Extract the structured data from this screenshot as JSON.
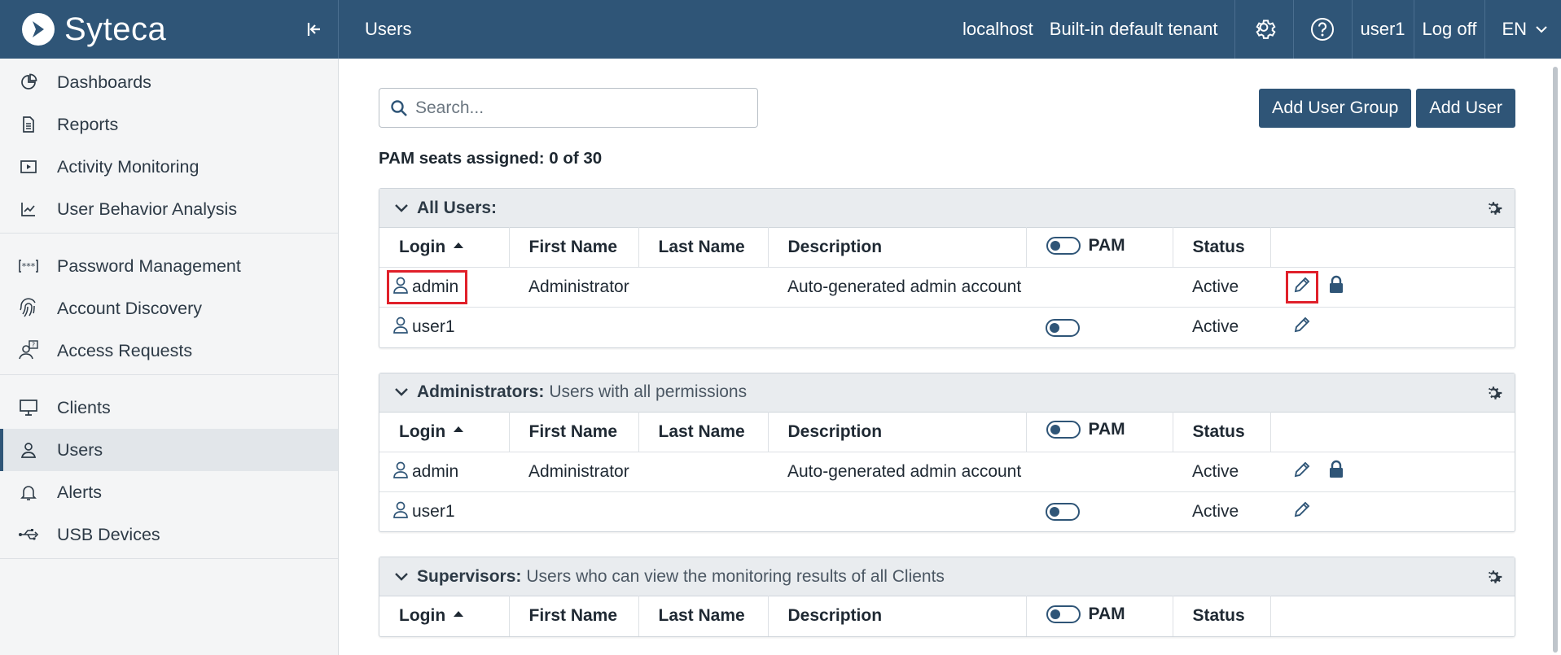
{
  "app": {
    "brand": "Syteca"
  },
  "header": {
    "page_title": "Users",
    "host": "localhost",
    "tenant": "Built-in default tenant",
    "user": "user1",
    "logoff": "Log off",
    "lang": "EN"
  },
  "sidebar": {
    "groups": [
      [
        {
          "label": "Dashboards",
          "icon": "pie-chart-icon"
        },
        {
          "label": "Reports",
          "icon": "document-icon"
        },
        {
          "label": "Activity Monitoring",
          "icon": "play-icon"
        },
        {
          "label": "User Behavior Analysis",
          "icon": "trend-chart-icon"
        }
      ],
      [
        {
          "label": "Password Management",
          "icon": "password-icon"
        },
        {
          "label": "Account Discovery",
          "icon": "fingerprint-icon"
        },
        {
          "label": "Access Requests",
          "icon": "user-question-icon"
        }
      ],
      [
        {
          "label": "Clients",
          "icon": "monitor-icon"
        },
        {
          "label": "Users",
          "icon": "user-icon",
          "active": true
        },
        {
          "label": "Alerts",
          "icon": "bell-icon"
        },
        {
          "label": "USB Devices",
          "icon": "usb-icon"
        }
      ]
    ]
  },
  "main": {
    "search_placeholder": "Search...",
    "add_group_label": "Add User Group",
    "add_user_label": "Add User",
    "seats": "PAM seats assigned: 0 of 30",
    "columns": {
      "login": "Login",
      "first": "First Name",
      "last": "Last Name",
      "desc": "Description",
      "pam": "PAM",
      "status": "Status"
    },
    "groups": [
      {
        "name": "All Users:",
        "desc": "",
        "rows": [
          {
            "login": "admin",
            "first": "Administrator",
            "last": "",
            "desc": "Auto-generated admin account",
            "pam_toggle": false,
            "status": "Active",
            "lock": true,
            "highlight": true
          },
          {
            "login": "user1",
            "first": "",
            "last": "",
            "desc": "",
            "pam_toggle": true,
            "status": "Active",
            "lock": false,
            "highlight": false
          }
        ]
      },
      {
        "name": "Administrators:",
        "desc": "Users with all permissions",
        "rows": [
          {
            "login": "admin",
            "first": "Administrator",
            "last": "",
            "desc": "Auto-generated admin account",
            "pam_toggle": false,
            "status": "Active",
            "lock": true,
            "highlight": false
          },
          {
            "login": "user1",
            "first": "",
            "last": "",
            "desc": "",
            "pam_toggle": true,
            "status": "Active",
            "lock": false,
            "highlight": false
          }
        ]
      },
      {
        "name": "Supervisors:",
        "desc": "Users who can view the monitoring results of all Clients",
        "rows": []
      }
    ]
  },
  "colors": {
    "brand": "#2f5577",
    "highlight": "#e0202a"
  }
}
